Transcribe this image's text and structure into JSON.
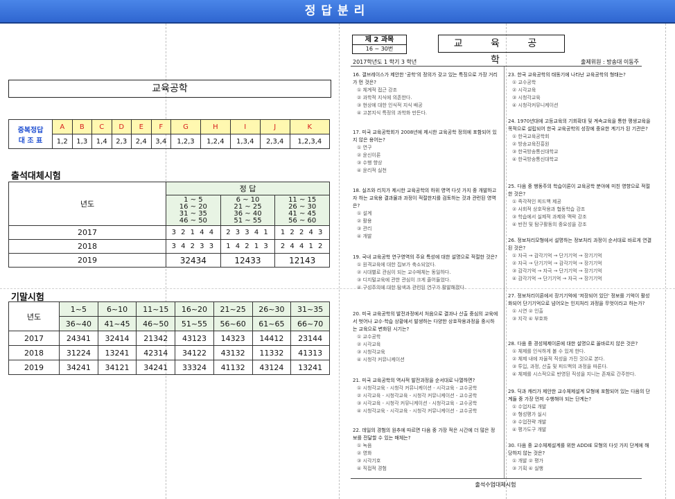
{
  "banner_title": "정답분리",
  "left": {
    "subject_title": "교육공학",
    "duplicate_answers": {
      "header": [
        "중복정답",
        "대 조 표"
      ],
      "letters": [
        "A",
        "B",
        "C",
        "D",
        "E",
        "F",
        "G",
        "H",
        "I",
        "J",
        "K"
      ],
      "values": [
        "1,2",
        "1,3",
        "1,4",
        "2,3",
        "2,4",
        "3,4",
        "1,2,3",
        "1,2,4",
        "1,3,4",
        "2,3,4",
        "1,2,3,4"
      ]
    },
    "attendance_section_label": "출석대체시험",
    "attendance": {
      "year_header": "년도",
      "answer_header": "정   답",
      "range_cols": [
        [
          "1 ~ 5",
          "16 ~ 20",
          "31 ~ 35",
          "46 ~ 50"
        ],
        [
          "6 ~ 10",
          "21 ~ 25",
          "36 ~ 40",
          "51 ~ 55"
        ],
        [
          "11 ~ 15",
          "26 ~ 30",
          "41 ~ 45",
          "56 ~ 60"
        ]
      ],
      "rows": [
        {
          "year": "2017",
          "a": "3 2 1 4 4",
          "b": "2 3 3 4 1",
          "c": "1 2 2 4 3"
        },
        {
          "year": "2018",
          "a": "3 4 2 3 3",
          "b": "1 4 2 1 3",
          "c": "2 4 4 1 2"
        },
        {
          "year": "2019",
          "a": "32434",
          "b": "12433",
          "c": "12143"
        }
      ]
    },
    "final_section_label": "기말시험",
    "final": {
      "year_header": "년도",
      "ranges_top": [
        "1~5",
        "6~10",
        "11~15",
        "16~20",
        "21~25",
        "26~30",
        "31~35"
      ],
      "ranges_bottom": [
        "36~40",
        "41~45",
        "46~50",
        "51~55",
        "56~60",
        "61~65",
        "66~70"
      ],
      "rows": [
        {
          "year": "2017",
          "values": [
            "24341",
            "32414",
            "21342",
            "43123",
            "14323",
            "14412",
            "23144"
          ]
        },
        {
          "year": "2018",
          "values": [
            "31224",
            "13241",
            "42314",
            "34122",
            "43132",
            "11332",
            "41313"
          ]
        },
        {
          "year": "2019",
          "values": [
            "34241",
            "34121",
            "34241",
            "33324",
            "41132",
            "43124",
            "13241"
          ]
        }
      ]
    }
  },
  "right": {
    "subject_no": "제 2 과목",
    "subject_range": "16 ~ 30번",
    "subject_title": "교 육 공 학",
    "year_info": "2017학년도  1  학기  3  학년",
    "author": "출제위원 : 방송대 이동주",
    "footer": "출석수업대체시험",
    "questions_left": [
      {
        "no": "16.",
        "text": "갤브레이스가 제안한 '공학'의 정의가 갖고 있는 특징으로 가장 거리가 먼 것은?",
        "opts": [
          "① 체계적 접근 강조",
          "② 과학적 지식에 의존한다.",
          "③ 현상에 대한 인식적 지식 배공",
          "④ 고본지식 특정의 과학화 만든다."
        ]
      },
      {
        "no": "17.",
        "text": "미국 교육공학회가 2008년에 제시한 교육공학 정의에 포함되어 있지 않은 용어는?",
        "opts": [
          "① 연구",
          "② 윤신이론",
          "③ 수행 향상",
          "④ 윤리적 실천"
        ]
      },
      {
        "no": "18.",
        "text": "실즈와 리치가 제시한 교육공학의 하위 영역 다섯 가지 중 개발하고자 하는 교육용 결과물과 과정이 적절한지를 검토하는 것과 관련된 영역은?",
        "opts": [
          "① 설계",
          "② 활용",
          "③ 관리",
          "④ 개발"
        ]
      },
      {
        "no": "19.",
        "text": "국내 교육공학 연구영역의 주요 특성에 대한 설명으로 적절한 것은?",
        "opts": [
          "① 원격교육에 대한 집보가 축소되었다.",
          "② 시대별로 관심이 되는 교수매체는 동일하다.",
          "③ 디지털교육에 관한 관심이 크게 줄어들었다.",
          "④ 구성주의에 대한 탐색과 관련된 연구가 활발해졌다."
        ]
      },
      {
        "no": "20.",
        "text": "미국 교육공학의 발전과정에서 처음으로 결과나 산출 중심의 교육에서 벗어나 교수·학습 상황에서 발생하는 다양한 상호작용과정을 중시하는 교육으로 변화된 시기는?",
        "opts": [
          "① 교수공학",
          "② 시각교육",
          "③ 시청각교육",
          "④ 시청각 커뮤니케이션"
        ]
      },
      {
        "no": "21.",
        "text": "미국 교육공학의 역사적 발전과정을 순서대로 나열하면?",
        "opts": [
          "① 시청각교육 - 시청각 커뮤니케이션 - 시각교육 - 교수공학",
          "② 시각교육 - 시청각교육 - 시청각 커뮤니케이션 - 교수공학",
          "③ 시각교육 - 시청각 커뮤니케이션 - 시청각교육 - 교수공학",
          "④ 시청각교육 - 시각교육 - 시청각 커뮤니케이션 - 교수공학"
        ]
      },
      {
        "no": "22.",
        "text": "데일의 경험의 원추에 따르면 다음 중 가장 적은 시간에 더 많은 정보를 전달할 수 있는 매체는?",
        "opts": [
          "① 녹음",
          "② 영화",
          "③ 시각기호",
          "④ 직접적 경험"
        ]
      }
    ],
    "questions_right": [
      {
        "no": "23.",
        "text": "한국 교육공학의 태동기에 나타난 교육공학의 형태는?",
        "opts": [
          "① 교수공학",
          "② 시각교육",
          "③ 시청각교육",
          "④ 시청각커뮤니케이션"
        ]
      },
      {
        "no": "24.",
        "text": "1970년대에 고등교육의 기회확대 및 계속교육을 통한 평생교육을 목적으로 설립되어 한국 교육공학의 성장에 중요한 계기가 된 기관은?",
        "opts": [
          "① 한국교육공학회",
          "② 방송교육진흥원",
          "③ 한국방송통신대학교",
          "④ 한국방송통신대학교"
        ]
      },
      {
        "no": "25.",
        "text": "다음 중 행동주의 학습이론이 교육공학 분야에 미친 영향으로 적절한 것은?",
        "opts": [
          "① 즉각적인 피드백 제공",
          "② 사회적 상호작용과 협동학습 강조",
          "③ 학습에서 실제적 과제와 맥락 강조",
          "④ 반전 및 탐구활동의 중요성을 강조"
        ]
      },
      {
        "no": "26.",
        "text": "정보처리모형에서 설명하는 정보처리 과정이 순서대로 바르게 연결된 것은?",
        "opts": [
          "① 자극 → 감각기억 → 단기기억 → 장기기억",
          "② 자극 → 단기기억 → 감각기억 → 장기기억",
          "③ 감각기억 → 자극 → 단기기억 → 장기기억",
          "④ 감각기억 → 단기기억 → 자극 → 장기기억"
        ]
      },
      {
        "no": "27.",
        "text": "정보처리이론에서 장기기억에 '저장되어 있던' 정보를 기억이 활성화되어 단기기억으로 넘어오는 인지처리 과정을 무엇이라고 하는가?",
        "opts": [
          "① 시연                ② 인출",
          "③ 지각                ④ 부호화"
        ]
      },
      {
        "no": "28.",
        "text": "다음 중 경성체제이론에 대한 설명으로 올바르지 않은 것은?",
        "opts": [
          "① 체제를 인식하게 볼 수 있게 한다.",
          "② 체제 내에 자율적 직성을 가진 것으로 본다.",
          "③ 투입, 과정, 산출 및 피드백의 과정을 따른다.",
          "④ 체제를 시스적으로 반영된 직성을 지니는 존재로 간주한다."
        ]
      },
      {
        "no": "29.",
        "text": "딕과 캐리가 제안한 교수체제설계 모형에 포함되어 있는 다음의 단계들 중 가장 먼저 수행해야 되는 단계는?",
        "opts": [
          "① 수업자료 개발",
          "② 형성평가 실시",
          "③ 수업전략 개발",
          "④ 평가도구 개발"
        ]
      },
      {
        "no": "30.",
        "text": "다음 중 교수체제설계를 위한 ADDIE 모형의 다섯 가지 단계에 해당하지 않는 것은?",
        "opts": [
          "① 개발                ② 평가",
          "③ 기획                ④ 실행"
        ]
      }
    ]
  }
}
